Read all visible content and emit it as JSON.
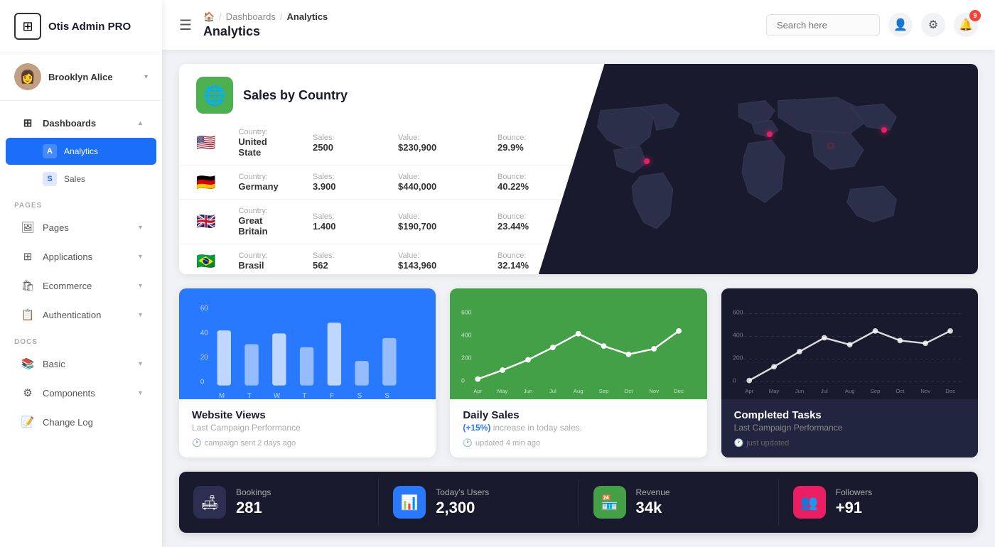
{
  "app": {
    "name": "Otis Admin PRO"
  },
  "user": {
    "name": "Brooklyn Alice",
    "avatar_emoji": "👩"
  },
  "header": {
    "breadcrumb_home": "🏠",
    "breadcrumb_dashboards": "Dashboards",
    "breadcrumb_current": "Analytics",
    "page_title": "Analytics",
    "menu_icon": "☰",
    "search_placeholder": "Search here",
    "notification_count": "9"
  },
  "sidebar": {
    "sections": [
      {
        "label": "",
        "items": [
          {
            "id": "dashboards",
            "label": "Dashboards",
            "icon": "⊞",
            "active": false,
            "has_children": true,
            "expanded": true
          },
          {
            "id": "analytics",
            "label": "Analytics",
            "icon": "A",
            "active": true,
            "is_sub": true
          },
          {
            "id": "sales",
            "label": "Sales",
            "icon": "S",
            "active": false,
            "is_sub": true
          }
        ]
      },
      {
        "label": "PAGES",
        "items": [
          {
            "id": "pages",
            "label": "Pages",
            "icon": "🖼",
            "has_children": true
          },
          {
            "id": "applications",
            "label": "Applications",
            "icon": "⊞",
            "has_children": true
          },
          {
            "id": "ecommerce",
            "label": "Ecommerce",
            "icon": "🛍",
            "has_children": true
          },
          {
            "id": "authentication",
            "label": "Authentication",
            "icon": "📋",
            "has_children": true
          }
        ]
      },
      {
        "label": "DOCS",
        "items": [
          {
            "id": "basic",
            "label": "Basic",
            "icon": "📚",
            "has_children": true
          },
          {
            "id": "components",
            "label": "Components",
            "icon": "⚙",
            "has_children": true
          },
          {
            "id": "changelog",
            "label": "Change Log",
            "icon": "📝"
          }
        ]
      }
    ]
  },
  "sales_by_country": {
    "title": "Sales by Country",
    "rows": [
      {
        "flag": "🇺🇸",
        "country_label": "Country:",
        "country": "United State",
        "sales_label": "Sales:",
        "sales": "2500",
        "value_label": "Value:",
        "value": "$230,900",
        "bounce_label": "Bounce:",
        "bounce": "29.9%"
      },
      {
        "flag": "🇩🇪",
        "country_label": "Country:",
        "country": "Germany",
        "sales_label": "Sales:",
        "sales": "3.900",
        "value_label": "Value:",
        "value": "$440,000",
        "bounce_label": "Bounce:",
        "bounce": "40.22%"
      },
      {
        "flag": "🇬🇧",
        "country_label": "Country:",
        "country": "Great Britain",
        "sales_label": "Sales:",
        "sales": "1.400",
        "value_label": "Value:",
        "value": "$190,700",
        "bounce_label": "Bounce:",
        "bounce": "23.44%"
      },
      {
        "flag": "🇧🇷",
        "country_label": "Country:",
        "country": "Brasil",
        "sales_label": "Sales:",
        "sales": "562",
        "value_label": "Value:",
        "value": "$143,960",
        "bounce_label": "Bounce:",
        "bounce": "32.14%"
      }
    ]
  },
  "charts": {
    "website_views": {
      "title": "Website Views",
      "subtitle": "Last Campaign Performance",
      "meta": "campaign sent 2 days ago",
      "y_labels": [
        "60",
        "40",
        "20",
        "0"
      ],
      "x_labels": [
        "M",
        "T",
        "W",
        "T",
        "F",
        "S",
        "S"
      ],
      "bars": [
        45,
        30,
        42,
        25,
        55,
        18,
        38
      ]
    },
    "daily_sales": {
      "title": "Daily Sales",
      "subtitle": "(+15%) increase in today sales.",
      "meta": "updated 4 min ago",
      "highlight": "(+15%)",
      "y_labels": [
        "600",
        "400",
        "200",
        "0"
      ],
      "x_labels": [
        "Apr",
        "May",
        "Jun",
        "Jul",
        "Aug",
        "Sep",
        "Oct",
        "Nov",
        "Dec"
      ],
      "points": [
        20,
        80,
        200,
        320,
        450,
        310,
        220,
        280,
        480
      ]
    },
    "completed_tasks": {
      "title": "Completed Tasks",
      "subtitle": "Last Campaign Performance",
      "meta": "just updated",
      "y_labels": [
        "600",
        "400",
        "200",
        "0"
      ],
      "x_labels": [
        "Apr",
        "May",
        "Jun",
        "Jul",
        "Aug",
        "Sep",
        "Oct",
        "Nov",
        "Dec"
      ],
      "points": [
        20,
        100,
        250,
        380,
        300,
        420,
        350,
        310,
        460
      ]
    }
  },
  "stats": [
    {
      "icon": "🛋",
      "icon_style": "dark",
      "label": "Bookings",
      "value": "281"
    },
    {
      "icon": "📊",
      "icon_style": "blue",
      "label": "Today's Users",
      "value": "2,300"
    },
    {
      "icon": "🏪",
      "icon_style": "green",
      "label": "Revenue",
      "value": "34k"
    },
    {
      "icon": "👥",
      "icon_style": "pink",
      "label": "Followers",
      "value": "+91"
    }
  ]
}
